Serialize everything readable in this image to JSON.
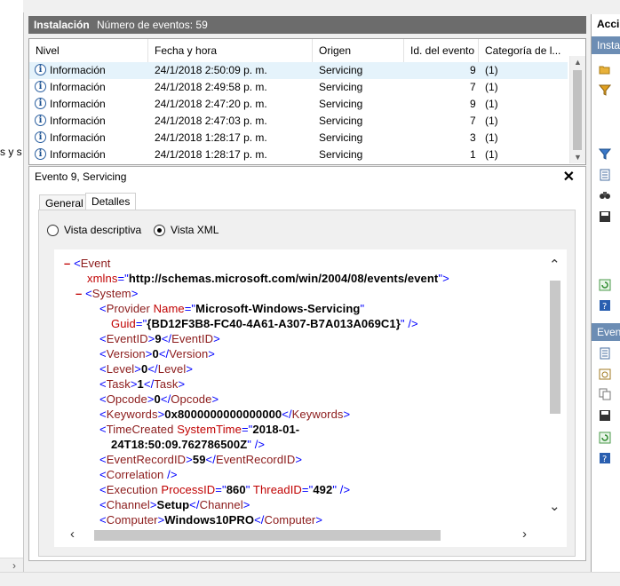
{
  "left_pane": {
    "fragment": "s y s"
  },
  "log_header": {
    "title": "Instalación",
    "event_count": "Número de eventos: 59"
  },
  "table": {
    "columns": [
      "Nivel",
      "Fecha y hora",
      "Origen",
      "Id. del evento",
      "Categoría de l..."
    ],
    "rows": [
      {
        "level": "Información",
        "datetime": "24/1/2018 2:50:09 p. m.",
        "source": "Servicing",
        "id": "9",
        "category": "(1)"
      },
      {
        "level": "Información",
        "datetime": "24/1/2018 2:49:58 p. m.",
        "source": "Servicing",
        "id": "7",
        "category": "(1)"
      },
      {
        "level": "Información",
        "datetime": "24/1/2018 2:47:20 p. m.",
        "source": "Servicing",
        "id": "9",
        "category": "(1)"
      },
      {
        "level": "Información",
        "datetime": "24/1/2018 2:47:03 p. m.",
        "source": "Servicing",
        "id": "7",
        "category": "(1)"
      },
      {
        "level": "Información",
        "datetime": "24/1/2018 1:28:17 p. m.",
        "source": "Servicing",
        "id": "3",
        "category": "(1)"
      },
      {
        "level": "Información",
        "datetime": "24/1/2018 1:28:17 p. m.",
        "source": "Servicing",
        "id": "1",
        "category": "(1)"
      }
    ]
  },
  "detail": {
    "title": "Evento 9, Servicing",
    "close": "✕",
    "tabs": [
      "General",
      "Detalles"
    ],
    "view_options": [
      "Vista descriptiva",
      "Vista XML"
    ],
    "selected_view": "Vista XML"
  },
  "xml": {
    "collapse_marker": "–",
    "event_tag": "Event",
    "xmlns_attr": "xmlns",
    "xmlns_value": "http://schemas.microsoft.com/win/2004/08/events/event",
    "system_tag": "System",
    "provider_tag": "Provider",
    "provider_name_attr": "Name",
    "provider_name": "Microsoft-Windows-Servicing",
    "guid_attr": "Guid",
    "guid": "{BD12F3B8-FC40-4A61-A307-B7A013A069C1}",
    "event_id_tag": "EventID",
    "event_id": "9",
    "version_tag": "Version",
    "version": "0",
    "level_tag": "Level",
    "level": "0",
    "task_tag": "Task",
    "task": "1",
    "opcode_tag": "Opcode",
    "opcode": "0",
    "keywords_tag": "Keywords",
    "keywords": "0x8000000000000000",
    "time_created_tag": "TimeCreated",
    "system_time_attr": "SystemTime",
    "system_time_part1": "2018-01-",
    "system_time_part2": "24T18:50:09.762786500Z",
    "record_id_tag": "EventRecordID",
    "record_id": "59",
    "correlation_tag": "Correlation",
    "execution_tag": "Execution",
    "process_id_attr": "ProcessID",
    "process_id": "860",
    "thread_id_attr": "ThreadID",
    "thread_id": "492",
    "channel_tag": "Channel",
    "channel": "Setup",
    "computer_tag": "Computer",
    "computer": "Windows10PRO"
  },
  "actions": {
    "header": "Acci",
    "section1": "Insta",
    "section2": "Even"
  },
  "colors": {
    "header_gray": "#6c6c6c",
    "selection": "#e5f3fb",
    "xml_markup": "#c00000",
    "xml_tag": "#8b1a1a",
    "xml_bracket": "#0000ff",
    "actions_section": "#6c8db4"
  }
}
